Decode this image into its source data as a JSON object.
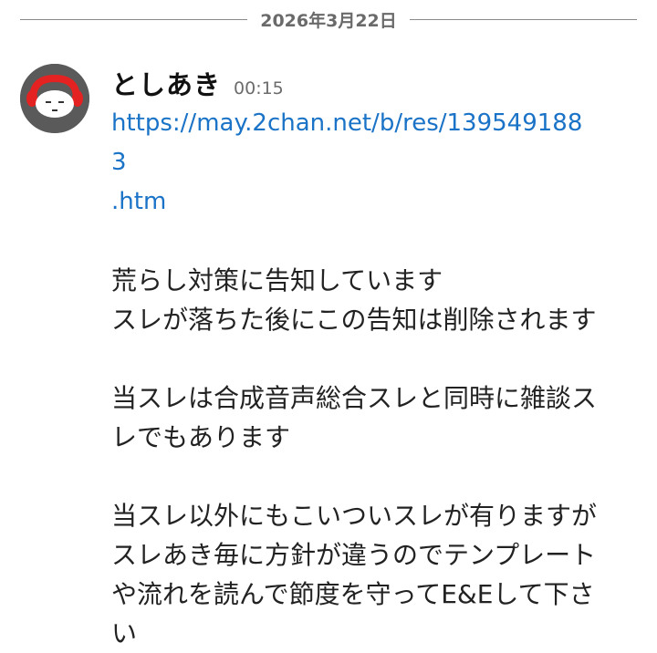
{
  "date_divider": {
    "label": "2026年3月22日"
  },
  "message": {
    "author": "としあき",
    "time": "00:15",
    "link": {
      "line1": "https://may.2chan.net/b/res/1395491883",
      "line2": ".htm"
    },
    "paragraphs": [
      {
        "lines": [
          "荒らし対策に告知しています",
          "スレが落ちた後にこの告知は削除されます"
        ]
      },
      {
        "lines": [
          "当スレは合成音声総合スレと同時に雑談ス",
          "レでもあります"
        ]
      },
      {
        "lines": [
          "当スレ以外にもこいついスレが有りますが",
          "スレあき毎に方針が違うのでテンプレート",
          "や流れを読んで節度を守ってE&Eして下さ",
          "い"
        ]
      }
    ]
  },
  "colors": {
    "link": "#1a73c7",
    "avatar_bg": "#5a5a5a",
    "avatar_accent": "#e52222"
  },
  "icons": {
    "avatar": "red-headphone-face-avatar"
  }
}
